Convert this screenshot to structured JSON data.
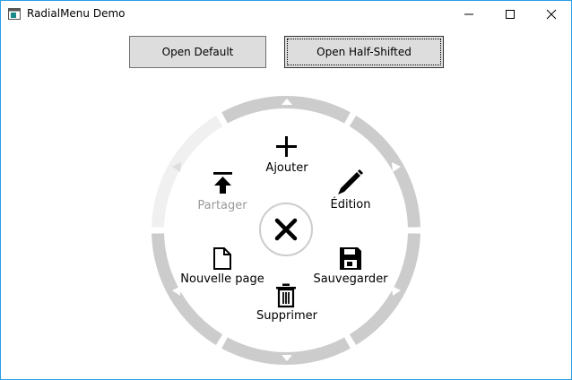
{
  "window": {
    "title": "RadialMenu Demo",
    "controls": [
      "minimize",
      "maximize",
      "close"
    ]
  },
  "buttons": {
    "open_default": "Open Default",
    "open_half_shifted": "Open Half-Shifted"
  },
  "radial_menu": {
    "center_icon": "close-icon",
    "items": [
      {
        "label": "Ajouter",
        "icon": "plus-icon",
        "enabled": true
      },
      {
        "label": "Édition",
        "icon": "pencil-icon",
        "enabled": true
      },
      {
        "label": "Sauvegarder",
        "icon": "save-icon",
        "enabled": true
      },
      {
        "label": "Supprimer",
        "icon": "trash-icon",
        "enabled": true
      },
      {
        "label": "Nouvelle page",
        "icon": "page-icon",
        "enabled": true
      },
      {
        "label": "Partager",
        "icon": "share-icon",
        "enabled": false
      }
    ]
  },
  "colors": {
    "ring": "#cccccc",
    "ring_disabled": "#f0f0f0",
    "button_bg": "#dddddd",
    "window_border": "#2b9ee8",
    "disabled_text": "#9a9a9a"
  }
}
